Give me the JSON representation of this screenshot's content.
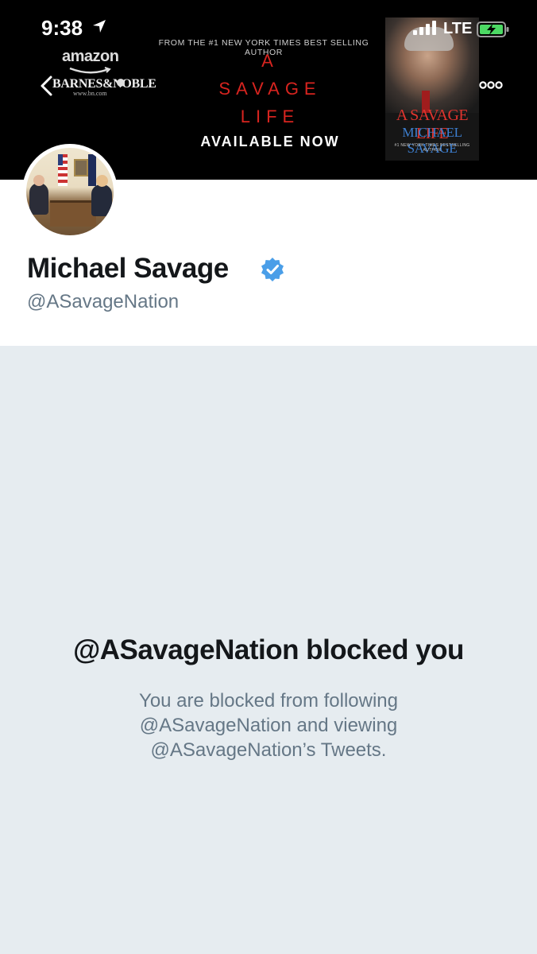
{
  "status_bar": {
    "time": "9:38",
    "carrier": "LTE",
    "icons": [
      "location-arrow-icon",
      "signal-bars-icon",
      "battery-charging-icon"
    ]
  },
  "header_banner": {
    "stores": {
      "amazon": "amazon",
      "barnes_noble": "BARNES&NOBLE",
      "barnes_noble_url": "www.bn.com"
    },
    "tagline": "FROM THE #1 NEW YORK TIMES BEST SELLING AUTHOR",
    "title_lines": [
      "A",
      "SAVAGE",
      "LIFE"
    ],
    "cta": "AVAILABLE NOW",
    "book": {
      "title": "A SAVAGE LIFE",
      "author": "MICHAEL SAVAGE",
      "subtitle": "#1 NEW YORK TIMES BESTSELLING AUTHOR"
    },
    "colors": {
      "title_red": "#d7241f",
      "author_blue": "#3d7fd0"
    }
  },
  "navigation": {
    "back_icon": "chevron-left-icon",
    "more_icon": "more-dots-icon"
  },
  "profile": {
    "display_name": "Michael Savage",
    "handle": "@ASavageNation",
    "verified": true,
    "verified_color": "#4a9ee8"
  },
  "blocked_notice": {
    "title": "@ASavageNation blocked you",
    "description_lines": [
      "You are blocked from following",
      "@ASavageNation and viewing",
      "@ASavageNation’s Tweets."
    ]
  }
}
